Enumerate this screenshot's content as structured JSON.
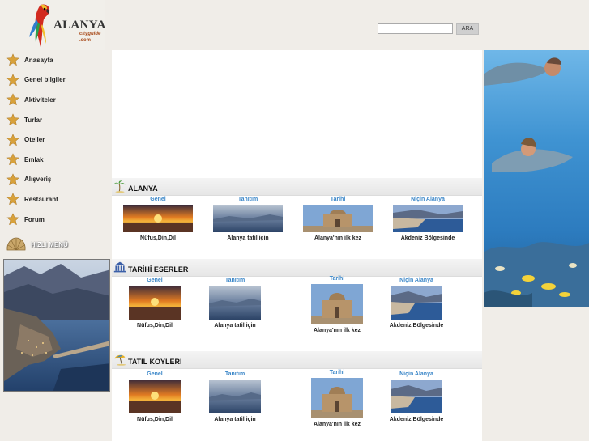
{
  "logo": {
    "brand": "ALANYA",
    "sub1": "cityguide",
    "sub2": ".com"
  },
  "search": {
    "value": "",
    "button_label": "ARA"
  },
  "nav": {
    "items": [
      {
        "label": "Anasayfa"
      },
      {
        "label": "Genel bilgiler"
      },
      {
        "label": "Aktiviteler"
      },
      {
        "label": "Turlar"
      },
      {
        "label": "Oteller"
      },
      {
        "label": "Emlak"
      },
      {
        "label": "Alışveriş"
      },
      {
        "label": "Restaurant"
      },
      {
        "label": "Forum"
      }
    ],
    "quick_menu_label": "HIZLI MENÜ"
  },
  "sections": [
    {
      "title": "ALANYA",
      "tiles": [
        {
          "link": "Genel",
          "caption": "Nüfus,Din,Dil",
          "image": "sunset"
        },
        {
          "link": "Tanıtım",
          "caption": "Alanya tatil için",
          "image": "sea"
        },
        {
          "link": "Tarihi",
          "caption": "Alanya'nın ilk kez",
          "image": "church"
        },
        {
          "link": "Niçin Alanya",
          "caption": "Akdeniz Bölgesinde",
          "image": "coast"
        }
      ]
    },
    {
      "title": "TARİHİ ESERLER",
      "tiles": [
        {
          "link": "Genel",
          "caption": "Nüfus,Din,Dil",
          "image": "sunset"
        },
        {
          "link": "Tanıtım",
          "caption": "Alanya tatil için",
          "image": "sea"
        },
        {
          "link": "Tarihi",
          "caption": "Alanya'nın ilk kez",
          "image": "church"
        },
        {
          "link": "Niçin Alanya",
          "caption": "Akdeniz Bölgesinde",
          "image": "coast"
        }
      ]
    },
    {
      "title": "TATİL KÖYLERİ",
      "tiles": [
        {
          "link": "Genel",
          "caption": "Nüfus,Din,Dil",
          "image": "sunset"
        },
        {
          "link": "Tanıtım",
          "caption": "Alanya tatil için",
          "image": "sea"
        },
        {
          "link": "Tarihi",
          "caption": "Alanya'nın ilk kez",
          "image": "church"
        },
        {
          "link": "Niçin Alanya",
          "caption": "Akdeniz Bölgesinde",
          "image": "coast"
        }
      ]
    }
  ],
  "colors": {
    "link_blue": "#3a86c8",
    "star": "#d8a13a",
    "background": "#f0ede8"
  }
}
